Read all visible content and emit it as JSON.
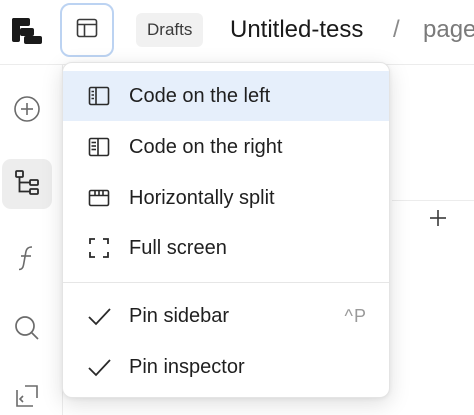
{
  "header": {
    "workspace_badge": "Drafts",
    "file_title": "Untitled-tess",
    "breadcrumb_separator": "/",
    "page_name": "page"
  },
  "icons": {
    "logo": "app-logo-icon",
    "layout_toggle": "layout-panels-icon",
    "rail": [
      "plus-circle-icon",
      "tree-structure-icon",
      "function-icon",
      "search-icon",
      "code-insert-icon"
    ],
    "add": "plus-icon"
  },
  "layout_menu": {
    "items": [
      {
        "label": "Code on the left",
        "icon": "code-left-layout-icon",
        "highlighted": true
      },
      {
        "label": "Code on the right",
        "icon": "code-right-layout-icon",
        "highlighted": false
      },
      {
        "label": "Horizontally split",
        "icon": "horizontal-split-layout-icon",
        "highlighted": false
      },
      {
        "label": "Full screen",
        "icon": "full-screen-icon",
        "highlighted": false
      }
    ],
    "toggles": [
      {
        "label": "Pin sidebar",
        "checked": true,
        "shortcut": "^P"
      },
      {
        "label": "Pin inspector",
        "checked": true,
        "shortcut": ""
      }
    ]
  },
  "colors": {
    "highlight": "#e6effb",
    "focus_ring": "#bcd3f2",
    "active_rail": "#ededed"
  }
}
